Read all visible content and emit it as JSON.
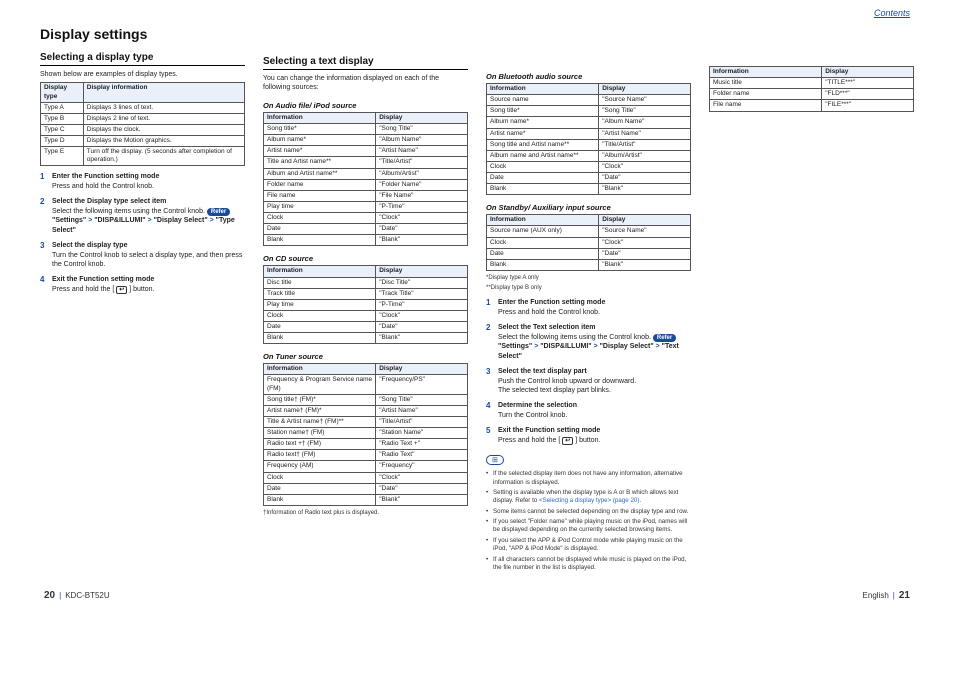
{
  "header": {
    "contentsLink": "Contents",
    "title": "Display settings"
  },
  "sec1": {
    "heading": "Selecting a display type",
    "intro": "Shown below are examples of display types."
  },
  "sec2": {
    "heading": "Selecting a text display",
    "intro": "You can change the information displayed on each of the following sources:"
  },
  "dtTable": {
    "h1": "Display type",
    "h2": "Display information",
    "r": [
      [
        "Type A",
        "Displays 3 lines of text."
      ],
      [
        "Type B",
        "Displays 2 line of text."
      ],
      [
        "Type C",
        "Displays the clock."
      ],
      [
        "Type D",
        "Displays the Motion graphics."
      ],
      [
        "Type E",
        "Turn off the display. (5 seconds after completion of operation.)"
      ]
    ]
  },
  "steps1": [
    {
      "b": "Enter the Function setting mode",
      "t": "Press and hold the Control knob."
    },
    {
      "b": "Select the Display type select item",
      "t": "Select the following items using the Control knob. ",
      "refer": "Refer",
      "seq": [
        "\"Settings\"",
        "\"DISP&ILLUMI\"",
        "\"Display Select\"",
        "\"Type Select\""
      ]
    },
    {
      "b": "Select the display type",
      "t": "Turn the Control knob to select a display type, and then press the Control knob."
    },
    {
      "b": "Exit the Function setting mode",
      "t": "Press and hold the [  ] button.",
      "ret": true
    }
  ],
  "audioTbl": {
    "cap": "On Audio file/ iPod source",
    "h1": "Information",
    "h2": "Display",
    "r": [
      [
        "Song title*",
        "\"Song Title\""
      ],
      [
        "Album name*",
        "\"Album Name\""
      ],
      [
        "Artist name*",
        "\"Artist Name\""
      ],
      [
        "Title and Artist name**",
        "\"Title/Artist\""
      ],
      [
        "Album and Artist name**",
        "\"Album/Artist\""
      ],
      [
        "Folder name",
        "\"Folder Name\""
      ],
      [
        "File name",
        "\"File Name\""
      ],
      [
        "Play time",
        "\"P-Time\""
      ],
      [
        "Clock",
        "\"Clock\""
      ],
      [
        "Date",
        "\"Date\""
      ],
      [
        "Blank",
        "\"Blank\""
      ]
    ]
  },
  "cdTbl": {
    "cap": "On CD source",
    "h1": "Information",
    "h2": "Display",
    "r": [
      [
        "Disc title",
        "\"Disc Title\""
      ],
      [
        "Track title",
        "\"Track Title\""
      ],
      [
        "Play time",
        "\"P-Time\""
      ],
      [
        "Clock",
        "\"Clock\""
      ],
      [
        "Date",
        "\"Date\""
      ],
      [
        "Blank",
        "\"Blank\""
      ]
    ]
  },
  "tunerTbl": {
    "cap": "On Tuner source",
    "h1": "Information",
    "h2": "Display",
    "r": [
      [
        "Frequency & Program Service name (FM)",
        "\"Frequency/PS\""
      ],
      [
        "Song title† (FM)*",
        "\"Song Title\""
      ],
      [
        "Artist name† (FM)*",
        "\"Artist Name\""
      ],
      [
        "Title & Artist name† (FM)**",
        "\"Title/Artist\""
      ],
      [
        "Station name† (FM)",
        "\"Station Name\""
      ],
      [
        "Radio text +† (FM)",
        "\"Radio Text +\""
      ],
      [
        "Radio text† (FM)",
        "\"Radio Text\""
      ],
      [
        "Frequency (AM)",
        "\"Frequency\""
      ],
      [
        "Clock",
        "\"Clock\""
      ],
      [
        "Date",
        "\"Date\""
      ],
      [
        "Blank",
        "\"Blank\""
      ]
    ],
    "foot": "†Information of Radio text plus is displayed."
  },
  "btTbl": {
    "cap": "On Bluetooth audio source",
    "h1": "Information",
    "h2": "Display",
    "r": [
      [
        "Source name",
        "\"Source Name\""
      ],
      [
        "Song title*",
        "\"Song Title\""
      ],
      [
        "Album name*",
        "\"Album Name\""
      ],
      [
        "Artist name*",
        "\"Artist Name\""
      ],
      [
        "Song title and Artist name**",
        "\"Title/Artist\""
      ],
      [
        "Album name and Artist name**",
        "\"Album/Artist\""
      ],
      [
        "Clock",
        "\"Clock\""
      ],
      [
        "Date",
        "\"Date\""
      ],
      [
        "Blank",
        "\"Blank\""
      ]
    ]
  },
  "sbTbl": {
    "cap": "On Standby/ Auxiliary input source",
    "h1": "Information",
    "h2": "Display",
    "r": [
      [
        "Source name (AUX only)",
        "\"Source Name\""
      ],
      [
        "Clock",
        "\"Clock\""
      ],
      [
        "Date",
        "\"Date\""
      ],
      [
        "Blank",
        "\"Blank\""
      ]
    ]
  },
  "extraTbl": {
    "h1": "Information",
    "h2": "Display",
    "r": [
      [
        "Music title",
        "\"TITLE***\""
      ],
      [
        "Folder name",
        "\"FLD***\""
      ],
      [
        "File name",
        "\"FILE***\""
      ]
    ]
  },
  "legend": {
    "a": "*Display type A only",
    "b": "**Display type B only"
  },
  "steps2": [
    {
      "b": "Enter the Function setting mode",
      "t": "Press and hold the Control knob."
    },
    {
      "b": "Select the Text selection item",
      "t": "Select the following items using the Control knob. ",
      "refer": "Refer",
      "seq": [
        "\"Settings\"",
        "\"DISP&ILLUMI\"",
        "\"Display Select\"",
        "\"Text Select\""
      ]
    },
    {
      "b": "Select the text display part",
      "t": "Push the Control knob upward or downward.",
      "after": "The selected text display part blinks."
    },
    {
      "b": "Determine the selection",
      "t": "Turn the Control knob."
    },
    {
      "b": "Exit the Function setting mode",
      "t": "Press and hold the [  ] button.",
      "ret": true
    }
  ],
  "bullets": [
    "If the selected display item does not have any information, alternative information is displayed.",
    "Setting is available when the display type is A or B which allows text display. Refer to <Selecting a display type> (page 20).",
    "Some items cannot be selected depending on the display type and row.",
    "If you select \"Folder name\" while playing music on the iPod, names will be displayed depending on the currently selected browsing items.",
    "If you select the APP & iPod Control mode while playing music on the iPod, \"APP & iPod Mode\" is displayed.",
    "If all characters cannot be displayed while music is played on the iPod, the file number in the list is displayed."
  ],
  "footer": {
    "pgL": "20",
    "model": "KDC-BT52U",
    "lang": "English",
    "pgR": "21"
  }
}
